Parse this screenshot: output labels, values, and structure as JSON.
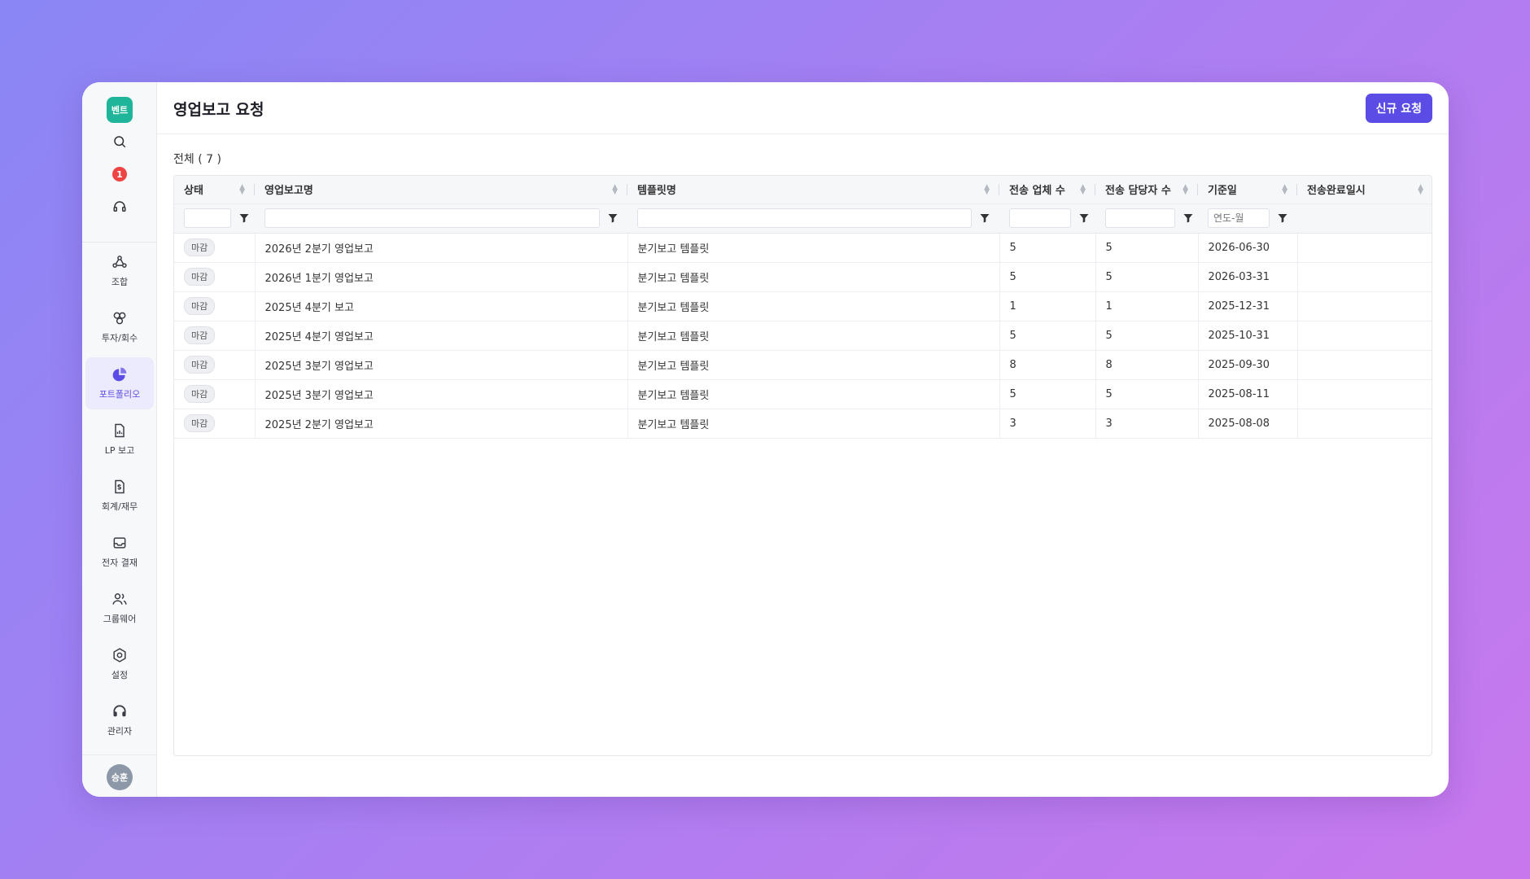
{
  "app": {
    "logo_text": "벤트"
  },
  "sidebar": {
    "notification_count": "1",
    "items": [
      {
        "label": "조합",
        "icon": "share-nodes-icon"
      },
      {
        "label": "투자/회수",
        "icon": "link-circles-icon"
      },
      {
        "label": "포트폴리오",
        "icon": "pie-chart-icon",
        "active": true
      },
      {
        "label": "LP 보고",
        "icon": "report-document-icon"
      },
      {
        "label": "회계/재무",
        "icon": "invoice-dollar-icon"
      },
      {
        "label": "전자 결재",
        "icon": "inbox-icon"
      },
      {
        "label": "그룹웨어",
        "icon": "users-icon"
      },
      {
        "label": "설정",
        "icon": "gear-icon"
      },
      {
        "label": "관리자",
        "icon": "headset-icon"
      }
    ],
    "user_avatar": "승훈"
  },
  "header": {
    "title": "영업보고 요청",
    "new_button_label": "신규 요청"
  },
  "content": {
    "total_label": "전체 ( 7 )"
  },
  "table": {
    "columns": [
      "상태",
      "영업보고명",
      "템플릿명",
      "전송 업체 수",
      "전송 담당자 수",
      "기준일",
      "전송완료일시"
    ],
    "date_filter_placeholder": "연도-월",
    "rows": [
      {
        "status": "마감",
        "name": "2026년 2분기 영업보고",
        "template": "분기보고 템플릿",
        "companies": "5",
        "managers": "5",
        "base_date": "2026-06-30",
        "completed_at": ""
      },
      {
        "status": "마감",
        "name": "2026년 1분기 영업보고",
        "template": "분기보고 템플릿",
        "companies": "5",
        "managers": "5",
        "base_date": "2026-03-31",
        "completed_at": ""
      },
      {
        "status": "마감",
        "name": "2025년 4분기 보고",
        "template": "분기보고 템플릿",
        "companies": "1",
        "managers": "1",
        "base_date": "2025-12-31",
        "completed_at": ""
      },
      {
        "status": "마감",
        "name": "2025년 4분기 영업보고",
        "template": "분기보고 템플릿",
        "companies": "5",
        "managers": "5",
        "base_date": "2025-10-31",
        "completed_at": ""
      },
      {
        "status": "마감",
        "name": "2025년 3분기 영업보고",
        "template": "분기보고 템플릿",
        "companies": "8",
        "managers": "8",
        "base_date": "2025-09-30",
        "completed_at": ""
      },
      {
        "status": "마감",
        "name": "2025년 3분기 영업보고",
        "template": "분기보고 템플릿",
        "companies": "5",
        "managers": "5",
        "base_date": "2025-08-11",
        "completed_at": ""
      },
      {
        "status": "마감",
        "name": "2025년 2분기 영업보고",
        "template": "분기보고 템플릿",
        "companies": "3",
        "managers": "3",
        "base_date": "2025-08-08",
        "completed_at": ""
      }
    ]
  },
  "colors": {
    "accent": "#5b4ce6",
    "logo": "#1fb59a",
    "badge": "#ef4444"
  }
}
